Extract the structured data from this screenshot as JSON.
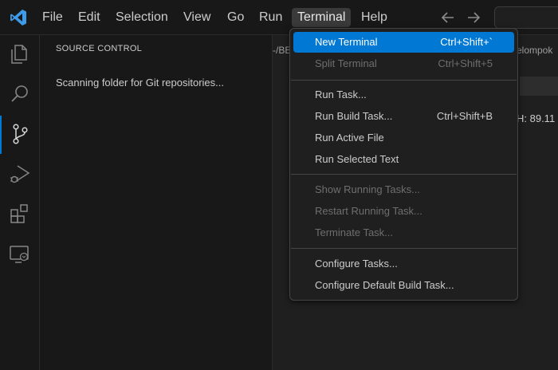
{
  "menubar": {
    "items": [
      {
        "label": "File"
      },
      {
        "label": "Edit"
      },
      {
        "label": "Selection"
      },
      {
        "label": "View"
      },
      {
        "label": "Go"
      },
      {
        "label": "Run"
      },
      {
        "label": "Terminal"
      },
      {
        "label": "Help"
      }
    ],
    "active": "Terminal"
  },
  "sidebar": {
    "title": "SOURCE CONTROL",
    "message": "Scanning folder for Git repositories..."
  },
  "editor": {
    "breadcrumb_left": "-/BE",
    "breadcrumb_right": "elompok",
    "partial_text": "H: 89.11"
  },
  "terminal_menu": {
    "items": [
      {
        "label": "New Terminal",
        "shortcut": "Ctrl+Shift+`",
        "enabled": true,
        "highlighted": true
      },
      {
        "label": "Split Terminal",
        "shortcut": "Ctrl+Shift+5",
        "enabled": false
      },
      {
        "label": "Run Task...",
        "shortcut": "",
        "enabled": true
      },
      {
        "label": "Run Build Task...",
        "shortcut": "Ctrl+Shift+B",
        "enabled": true
      },
      {
        "label": "Run Active File",
        "shortcut": "",
        "enabled": true
      },
      {
        "label": "Run Selected Text",
        "shortcut": "",
        "enabled": true
      },
      {
        "label": "Show Running Tasks...",
        "shortcut": "",
        "enabled": false
      },
      {
        "label": "Restart Running Task...",
        "shortcut": "",
        "enabled": false
      },
      {
        "label": "Terminate Task...",
        "shortcut": "",
        "enabled": false
      },
      {
        "label": "Configure Tasks...",
        "shortcut": "",
        "enabled": true
      },
      {
        "label": "Configure Default Build Task...",
        "shortcut": "",
        "enabled": true
      }
    ]
  },
  "colors": {
    "accent": "#0078d4",
    "background": "#1f1f1f",
    "bar_background": "#181818",
    "disabled_text": "#6e6e6e"
  },
  "icons": {
    "logo": "vscode-logo-icon",
    "activity": [
      "files-icon",
      "search-icon",
      "source-control-icon",
      "run-debug-icon",
      "extensions-icon",
      "remote-explorer-icon"
    ],
    "nav": [
      "arrow-left-icon",
      "arrow-right-icon"
    ]
  }
}
